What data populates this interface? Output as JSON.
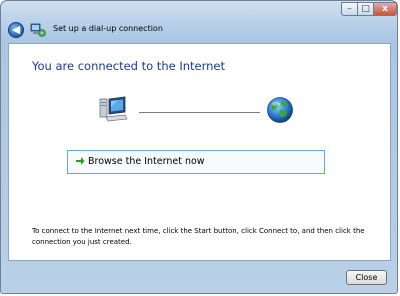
{
  "window": {
    "title": "Set up a dial-up connection",
    "controls": {
      "minimize": "–",
      "maximize": "□",
      "close": "x"
    }
  },
  "nav": {
    "back_glyph": "◀",
    "back_icon": "back-arrow-icon",
    "wizard_icon": "network-wizard-icon"
  },
  "main": {
    "heading": "You are connected to the Internet",
    "diagram": {
      "left_icon": "computer-icon",
      "right_icon": "globe-icon"
    },
    "browse": {
      "icon": "green-arrow-icon",
      "label": "Browse the Internet now"
    },
    "instructions": "To connect to the Internet next time, click the Start button, click Connect to, and then click the connection you just created."
  },
  "footer": {
    "close_label": "Close"
  },
  "colors": {
    "heading": "#1e3a8a",
    "frame": "#b9d0e8",
    "accent_arrow": "#2f9a1f",
    "button_border": "#6fa6d6"
  }
}
